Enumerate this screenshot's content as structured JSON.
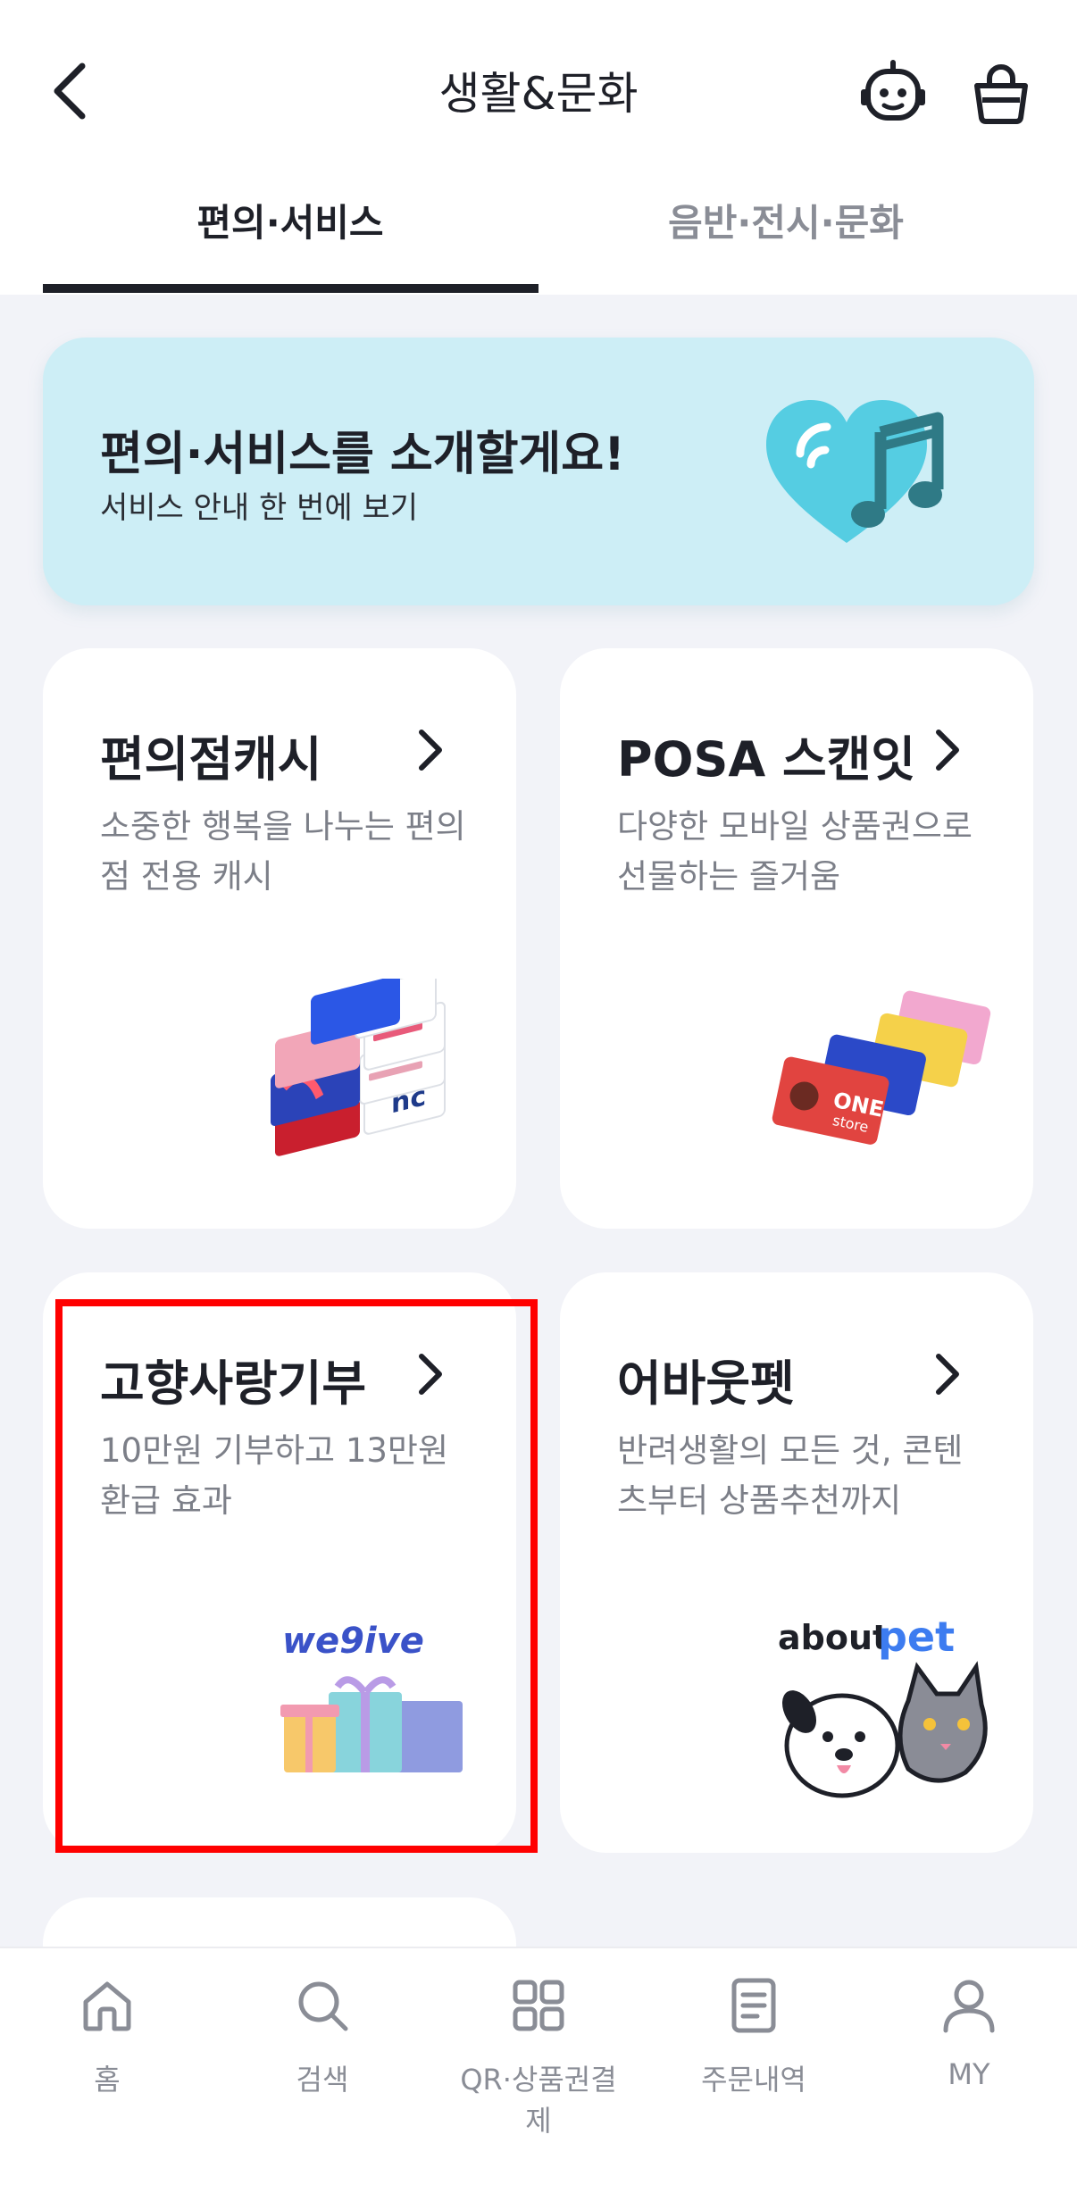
{
  "header": {
    "title": "생활&문화",
    "back_icon": "chevron-left-icon",
    "robot_icon": "robot-icon",
    "cart_icon": "shopping-bag-icon"
  },
  "tabs": [
    {
      "label": "편의·서비스",
      "active": true
    },
    {
      "label": "음반·전시·문화",
      "active": false
    }
  ],
  "banner": {
    "title": "편의·서비스를 소개할게요!",
    "subtitle": "서비스 안내 한 번에 보기",
    "illustration": "heart-music-icon"
  },
  "cards": [
    {
      "title": "편의점캐시",
      "desc": "소중한 행복을 나누는 편의점 전용 캐시",
      "illustration": "gift-cards-stack"
    },
    {
      "title": "POSA 스캔잇",
      "desc": "다양한 모바일 상품권으로 선물하는 즐거움",
      "illustration": "mobile-gift-cards"
    },
    {
      "title": "고향사랑기부",
      "desc": "10만원 기부하고 13만원 환급 효과",
      "logo": "we9ive",
      "illustration": "gift-boxes"
    },
    {
      "title": "어바웃펫",
      "desc": "반려생활의 모든 것, 콘텐츠부터 상품추천까지",
      "logo_prefix": "about",
      "logo_suffix": "pet",
      "illustration": "dog-and-cat"
    }
  ],
  "highlight_color": "#ff0000",
  "card_art_labels": {
    "one_store": "ONE",
    "one_store_sub": "store"
  },
  "bottom_nav": [
    {
      "label": "홈",
      "icon": "home-icon"
    },
    {
      "label": "검색",
      "icon": "search-icon"
    },
    {
      "label": "QR·상품권결제",
      "icon": "qr-icon"
    },
    {
      "label": "주문내역",
      "icon": "receipt-icon"
    },
    {
      "label": "MY",
      "icon": "user-icon"
    }
  ]
}
